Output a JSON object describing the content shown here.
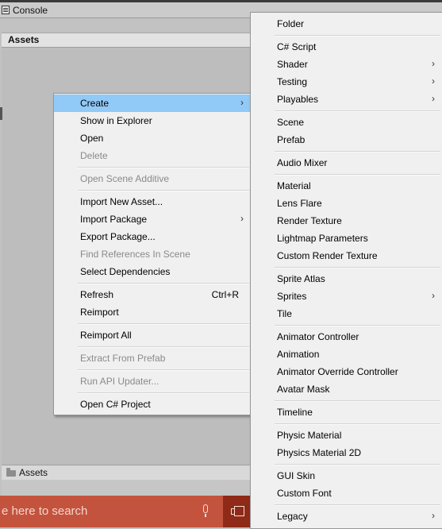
{
  "window": {
    "console_tab": "Console",
    "project_header": "Assets",
    "breadcrumb": "Assets"
  },
  "taskbar": {
    "search_placeholder": "e here to search"
  },
  "context_menu": {
    "items": [
      {
        "label": "Create",
        "submenu": true,
        "highlight": true
      },
      {
        "label": "Show in Explorer"
      },
      {
        "label": "Open"
      },
      {
        "label": "Delete",
        "disabled": true
      },
      {
        "label": "Open Scene Additive",
        "disabled": true
      },
      {
        "label": "Import New Asset..."
      },
      {
        "label": "Import Package",
        "submenu": true
      },
      {
        "label": "Export Package..."
      },
      {
        "label": "Find References In Scene",
        "disabled": true
      },
      {
        "label": "Select Dependencies"
      },
      {
        "label": "Refresh",
        "shortcut": "Ctrl+R"
      },
      {
        "label": "Reimport"
      },
      {
        "label": "Reimport All"
      },
      {
        "label": "Extract From Prefab",
        "disabled": true
      },
      {
        "label": "Run API Updater...",
        "disabled": true
      },
      {
        "label": "Open C# Project"
      }
    ]
  },
  "create_menu": {
    "items": [
      {
        "label": "Folder"
      },
      {
        "label": "C# Script"
      },
      {
        "label": "Shader",
        "submenu": true
      },
      {
        "label": "Testing",
        "submenu": true
      },
      {
        "label": "Playables",
        "submenu": true
      },
      {
        "label": "Scene"
      },
      {
        "label": "Prefab"
      },
      {
        "label": "Audio Mixer"
      },
      {
        "label": "Material"
      },
      {
        "label": "Lens Flare"
      },
      {
        "label": "Render Texture"
      },
      {
        "label": "Lightmap Parameters"
      },
      {
        "label": "Custom Render Texture"
      },
      {
        "label": "Sprite Atlas"
      },
      {
        "label": "Sprites",
        "submenu": true
      },
      {
        "label": "Tile"
      },
      {
        "label": "Animator Controller"
      },
      {
        "label": "Animation"
      },
      {
        "label": "Animator Override Controller"
      },
      {
        "label": "Avatar Mask"
      },
      {
        "label": "Timeline"
      },
      {
        "label": "Physic Material"
      },
      {
        "label": "Physics Material 2D"
      },
      {
        "label": "GUI Skin"
      },
      {
        "label": "Custom Font"
      },
      {
        "label": "Legacy",
        "submenu": true
      }
    ]
  },
  "colors": {
    "highlight": "#91c9f7",
    "taskbar": "#c4533e",
    "taskview": "#8e2a17",
    "disabled_text": "#8a8a8a"
  },
  "icons": [
    "console-icon",
    "folder-icon",
    "microphone-icon",
    "task-view-icon",
    "chevron-right-icon"
  ]
}
